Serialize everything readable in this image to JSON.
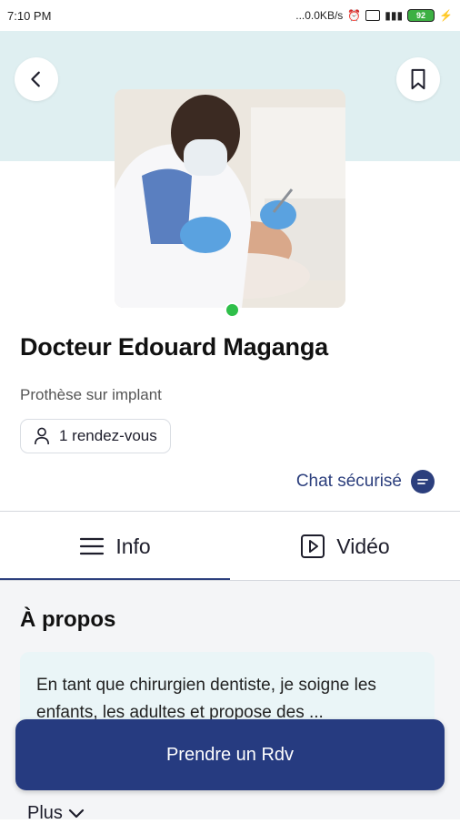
{
  "status_bar": {
    "time": "7:10 PM",
    "network_speed": "...0.0KB/s",
    "battery": "92"
  },
  "header": {
    "back_icon": "chevron-left-icon",
    "bookmark_icon": "bookmark-icon"
  },
  "profile": {
    "name": "Docteur Edouard Maganga",
    "specialty": "Prothèse sur implant",
    "appointments": "1 rendez-vous",
    "online": true,
    "online_color": "#2fbf4a"
  },
  "chat": {
    "label": "Chat sécurisé",
    "icon": "chat-bubble-icon"
  },
  "tabs": [
    {
      "label": "Info",
      "icon": "menu-icon",
      "active": true
    },
    {
      "label": "Vidéo",
      "icon": "play-icon",
      "active": false
    }
  ],
  "about": {
    "title": "À propos",
    "text": "En tant que chirurgien dentiste, je soigne les enfants, les adultes et propose des ..."
  },
  "cta": {
    "label": "Prendre un Rdv"
  },
  "more": {
    "label": "Plus"
  },
  "colors": {
    "primary": "#263b80",
    "hero_bg": "#dfeff1",
    "card_bg": "#eaf5f7"
  }
}
